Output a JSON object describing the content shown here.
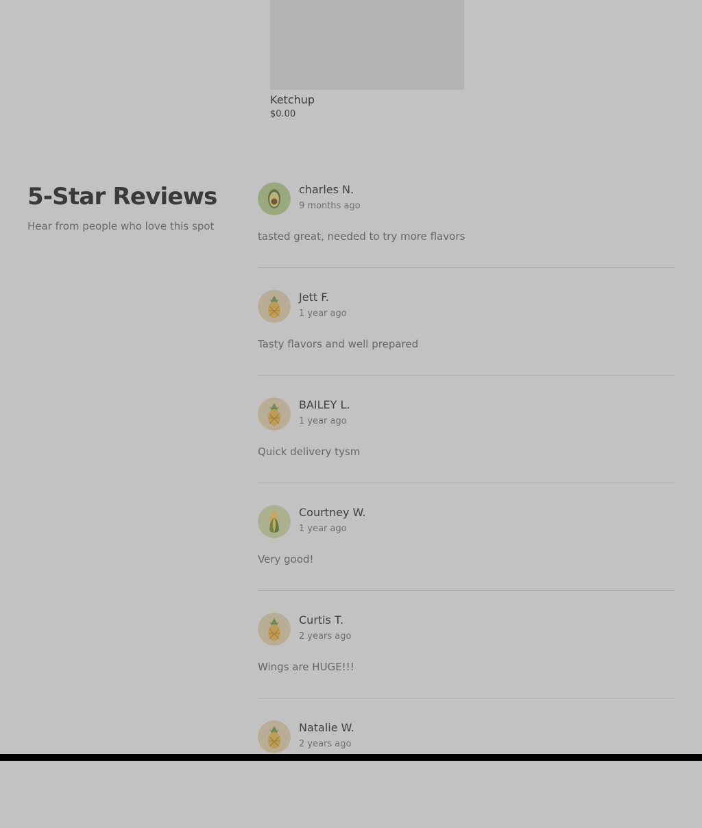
{
  "product": {
    "name": "Ketchup",
    "price": "$0.00"
  },
  "reviews_section": {
    "title": "5-Star Reviews",
    "subtitle": "Hear from people who love this spot",
    "items": [
      {
        "name": "charles N.",
        "time": "9 months ago",
        "text": "tasted great, needed to try more flavors",
        "avatar_icon": "avocado-icon"
      },
      {
        "name": "Jett F.",
        "time": "1 year ago",
        "text": "Tasty flavors and well prepared",
        "avatar_icon": "pineapple-icon"
      },
      {
        "name": "BAILEY L.",
        "time": "1 year ago",
        "text": "Quick delivery tysm",
        "avatar_icon": "pineapple-icon"
      },
      {
        "name": "Courtney W.",
        "time": "1 year ago",
        "text": "Very good!",
        "avatar_icon": "corn-icon"
      },
      {
        "name": "Curtis T.",
        "time": "2 years ago",
        "text": "Wings are HUGE!!!",
        "avatar_icon": "pineapple-icon"
      },
      {
        "name": "Natalie W.",
        "time": "2 years ago",
        "text": "",
        "avatar_icon": "pineapple-icon"
      }
    ]
  },
  "colors": {
    "overlay_background": "#c2c2c2",
    "image_placeholder": "#b3b3b3",
    "divider": "#aeaeae",
    "avocado_avatar_bg": "#9aa97d",
    "pineapple_avatar_bg": "#b9ad96",
    "corn_avatar_bg": "#acb08f"
  }
}
